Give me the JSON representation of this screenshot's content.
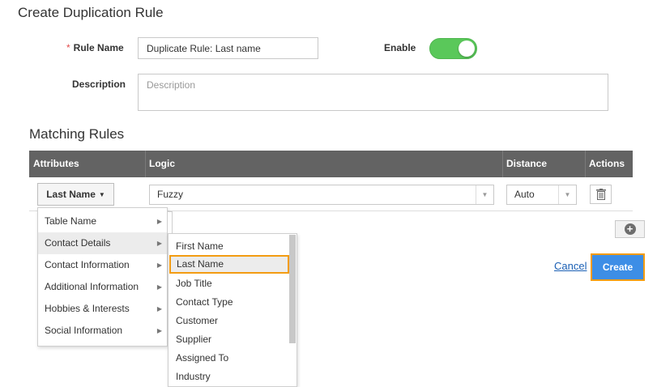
{
  "page": {
    "title": "Create Duplication Rule"
  },
  "form": {
    "rule_name_label": "Rule Name",
    "required_marker": "*",
    "rule_name_value": "Duplicate Rule: Last name",
    "enable_label": "Enable",
    "enable_state": "on",
    "description_label": "Description",
    "description_placeholder": "Description"
  },
  "matching": {
    "title": "Matching Rules",
    "columns": {
      "attributes": "Attributes",
      "logic": "Logic",
      "distance": "Distance",
      "actions": "Actions"
    },
    "row": {
      "attribute": "Last Name",
      "logic": "Fuzzy",
      "distance": "Auto"
    }
  },
  "attribute_menu": {
    "groups": [
      {
        "label": "Table Name"
      },
      {
        "label": "Contact Details"
      },
      {
        "label": "Contact Information"
      },
      {
        "label": "Additional Information"
      },
      {
        "label": "Hobbies & Interests"
      },
      {
        "label": "Social Information"
      }
    ],
    "active_group": "Contact Details",
    "fields": [
      {
        "label": "First Name"
      },
      {
        "label": "Last Name"
      },
      {
        "label": "Job Title"
      },
      {
        "label": "Contact Type"
      },
      {
        "label": "Customer"
      },
      {
        "label": "Supplier"
      },
      {
        "label": "Assigned To"
      },
      {
        "label": "Industry"
      }
    ],
    "selected_field": "Last Name"
  },
  "actions": {
    "cancel_label": "Cancel",
    "create_label": "Create"
  },
  "colors": {
    "header_bg": "#636363",
    "toggle_on": "#5ac85a",
    "primary_button": "#3d8ee6",
    "highlight_outline": "#f39c12",
    "link": "#1a5fb4"
  },
  "icons": {
    "toggle_knob": "toggle-knob",
    "trash": "trash-icon",
    "add": "plus-circle-icon",
    "submenu": "chevron-right-icon",
    "dropdown": "chevron-down-icon"
  }
}
